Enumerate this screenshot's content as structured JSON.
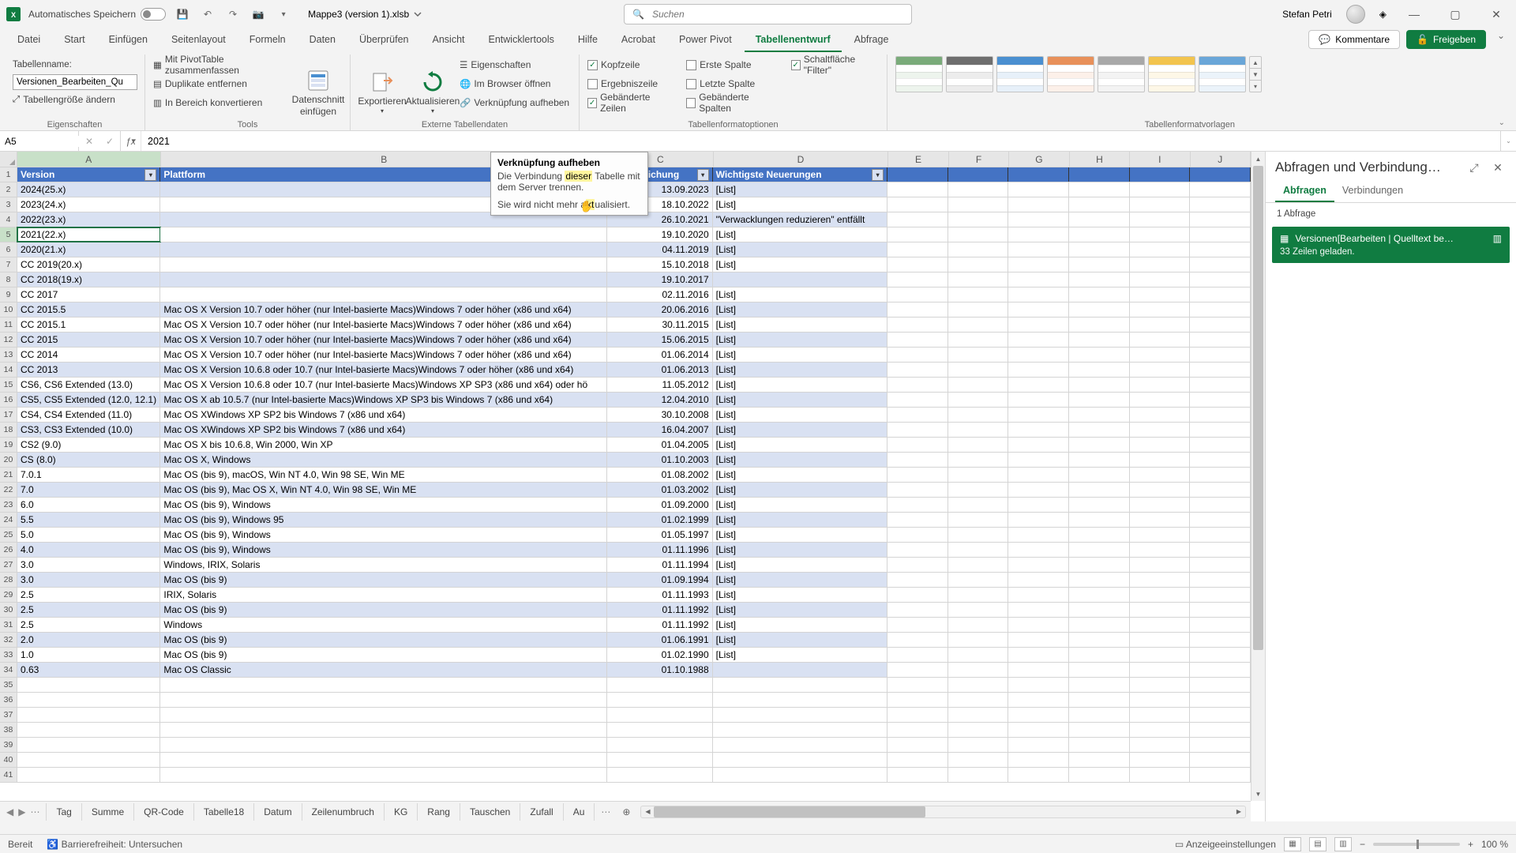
{
  "titlebar": {
    "auto_save_label": "Automatisches Speichern",
    "filename": "Mappe3 (version 1).xlsb",
    "search_placeholder": "Suchen",
    "user_name": "Stefan Petri"
  },
  "ribbon_tabs": [
    "Datei",
    "Start",
    "Einfügen",
    "Seitenlayout",
    "Formeln",
    "Daten",
    "Überprüfen",
    "Ansicht",
    "Entwicklertools",
    "Hilfe",
    "Acrobat",
    "Power Pivot",
    "Tabellenentwurf",
    "Abfrage"
  ],
  "ribbon_tabs_active": 12,
  "ribbon_right": {
    "comments": "Kommentare",
    "share": "Freigeben"
  },
  "groups": {
    "props": {
      "name_label": "Tabellenname:",
      "name_value": "Versionen_Bearbeiten_Qu",
      "resize": "Tabellengröße ändern",
      "group_label": "Eigenschaften"
    },
    "tools": {
      "pivot": "Mit PivotTable zusammenfassen",
      "dupes": "Duplikate entfernen",
      "convert": "In Bereich konvertieren",
      "slicer_top": "Datenschnitt",
      "slicer_bot": "einfügen",
      "group_label": "Tools"
    },
    "external": {
      "export": "Exportieren",
      "refresh": "Aktualisieren",
      "props": "Eigenschaften",
      "browser": "Im Browser öffnen",
      "unlink": "Verknüpfung aufheben",
      "group_label": "Externe Tabellendaten"
    },
    "styleopts": {
      "header_row": "Kopfzeile",
      "total_row": "Ergebniszeile",
      "banded_rows": "Gebänderte Zeilen",
      "first_col": "Erste Spalte",
      "last_col": "Letzte Spalte",
      "banded_cols": "Gebänderte Spalten",
      "filter_btn": "Schaltfläche \"Filter\"",
      "group_label": "Tabellenformatoptionen"
    },
    "styles": {
      "group_label": "Tabellenformatvorlagen"
    }
  },
  "style_colors": [
    "#7aab7a",
    "#6e6e6e",
    "#4a8fd0",
    "#e8905a",
    "#a8a8a8",
    "#f2c44e",
    "#6aa6d8"
  ],
  "namebox": "A5",
  "formula": "2021",
  "col_letters": [
    "A",
    "B",
    "C",
    "D",
    "E",
    "F",
    "G",
    "H",
    "I",
    "J"
  ],
  "table_headers": [
    "Version",
    "Plattform",
    "eröffentlichung",
    "Wichtigste Neuerungen"
  ],
  "rows": [
    {
      "v": "2024(25.x)",
      "p": "",
      "d": "13.09.2023",
      "n": "[List]"
    },
    {
      "v": "2023(24.x)",
      "p": "",
      "d": "18.10.2022",
      "n": "[List]"
    },
    {
      "v": "2022(23.x)",
      "p": "",
      "d": "26.10.2021",
      "n": "\"Verwacklungen reduzieren\" entfällt"
    },
    {
      "v": "2021(22.x)",
      "p": "",
      "d": "19.10.2020",
      "n": "[List]"
    },
    {
      "v": "2020(21.x)",
      "p": "",
      "d": "04.11.2019",
      "n": "[List]"
    },
    {
      "v": "CC 2019(20.x)",
      "p": "",
      "d": "15.10.2018",
      "n": "[List]"
    },
    {
      "v": "CC 2018(19.x)",
      "p": "",
      "d": "19.10.2017",
      "n": ""
    },
    {
      "v": "CC 2017",
      "p": "",
      "d": "02.11.2016",
      "n": "[List]"
    },
    {
      "v": "CC 2015.5",
      "p": "Mac OS X Version 10.7 oder höher (nur Intel-basierte Macs)Windows 7 oder höher (x86 und x64)",
      "d": "20.06.2016",
      "n": "[List]"
    },
    {
      "v": "CC 2015.1",
      "p": "Mac OS X Version 10.7 oder höher (nur Intel-basierte Macs)Windows 7 oder höher (x86 und x64)",
      "d": "30.11.2015",
      "n": "[List]"
    },
    {
      "v": "CC 2015",
      "p": "Mac OS X Version 10.7 oder höher (nur Intel-basierte Macs)Windows 7 oder höher (x86 und x64)",
      "d": "15.06.2015",
      "n": "[List]"
    },
    {
      "v": "CC 2014",
      "p": "Mac OS X Version 10.7 oder höher (nur Intel-basierte Macs)Windows 7 oder höher (x86 und x64)",
      "d": "01.06.2014",
      "n": "[List]"
    },
    {
      "v": "CC 2013",
      "p": "Mac OS X Version 10.6.8 oder 10.7 (nur Intel-basierte Macs)Windows 7 oder höher (x86 und x64)",
      "d": "01.06.2013",
      "n": "[List]"
    },
    {
      "v": "CS6, CS6 Extended (13.0)",
      "p": "Mac OS X Version 10.6.8 oder 10.7 (nur Intel-basierte Macs)Windows XP SP3 (x86 und x64) oder hö",
      "d": "11.05.2012",
      "n": "[List]"
    },
    {
      "v": "CS5, CS5 Extended (12.0, 12.1)",
      "p": "Mac OS X ab 10.5.7 (nur Intel-basierte Macs)Windows XP SP3 bis Windows 7 (x86 und x64)",
      "d": "12.04.2010",
      "n": "[List]"
    },
    {
      "v": "CS4, CS4 Extended (11.0)",
      "p": "Mac OS XWindows XP SP2 bis Windows 7 (x86 und x64)",
      "d": "30.10.2008",
      "n": "[List]"
    },
    {
      "v": "CS3, CS3 Extended (10.0)",
      "p": "Mac OS XWindows XP SP2 bis Windows 7 (x86 und x64)",
      "d": "16.04.2007",
      "n": "[List]"
    },
    {
      "v": "CS2 (9.0)",
      "p": "Mac OS X bis 10.6.8, Win 2000, Win XP",
      "d": "01.04.2005",
      "n": "[List]"
    },
    {
      "v": "CS (8.0)",
      "p": "Mac OS X, Windows",
      "d": "01.10.2003",
      "n": "[List]"
    },
    {
      "v": "7.0.1",
      "p": "Mac OS (bis 9), macOS, Win NT 4.0, Win 98 SE, Win ME",
      "d": "01.08.2002",
      "n": "[List]"
    },
    {
      "v": "7.0",
      "p": "Mac OS (bis 9), Mac OS X, Win NT 4.0, Win 98 SE, Win ME",
      "d": "01.03.2002",
      "n": "[List]"
    },
    {
      "v": "6.0",
      "p": "Mac OS (bis 9), Windows",
      "d": "01.09.2000",
      "n": "[List]"
    },
    {
      "v": "5.5",
      "p": "Mac OS (bis 9), Windows 95",
      "d": "01.02.1999",
      "n": "[List]"
    },
    {
      "v": "5.0",
      "p": "Mac OS (bis 9), Windows",
      "d": "01.05.1997",
      "n": "[List]"
    },
    {
      "v": "4.0",
      "p": "Mac OS (bis 9), Windows",
      "d": "01.11.1996",
      "n": "[List]"
    },
    {
      "v": "3.0",
      "p": "Windows, IRIX, Solaris",
      "d": "01.11.1994",
      "n": "[List]"
    },
    {
      "v": "3.0",
      "p": "Mac OS (bis 9)",
      "d": "01.09.1994",
      "n": "[List]"
    },
    {
      "v": "2.5",
      "p": "IRIX, Solaris",
      "d": "01.11.1993",
      "n": "[List]"
    },
    {
      "v": "2.5",
      "p": "Mac OS (bis 9)",
      "d": "01.11.1992",
      "n": "[List]"
    },
    {
      "v": "2.5",
      "p": "Windows",
      "d": "01.11.1992",
      "n": "[List]"
    },
    {
      "v": "2.0",
      "p": "Mac OS (bis 9)",
      "d": "01.06.1991",
      "n": "[List]"
    },
    {
      "v": "1.0",
      "p": "Mac OS (bis 9)",
      "d": "01.02.1990",
      "n": "[List]"
    },
    {
      "v": "0.63",
      "p": "Mac OS Classic",
      "d": "01.10.1988",
      "n": ""
    }
  ],
  "selected_row_index": 3,
  "tooltip": {
    "title": "Verknüpfung aufheben",
    "body_a": "Die Verbindung ",
    "body_hi1": "dieser",
    "body_b": " Tabelle mit dem Server trennen.",
    "foot_a": "Sie wird nicht mehr a",
    "foot_hi": "kt",
    "foot_b": "ualisiert."
  },
  "tabs": [
    "Tag",
    "Summe",
    "QR-Code",
    "Tabelle18",
    "Datum",
    "Zeilenumbruch",
    "KG",
    "Rang",
    "Tauschen",
    "Zufall",
    "Au"
  ],
  "side": {
    "title": "Abfragen und Verbindung…",
    "tab1": "Abfragen",
    "tab2": "Verbindungen",
    "count": "1 Abfrage",
    "query_name": "Versionen[Bearbeiten | Quelltext be…",
    "query_sub": "33 Zeilen geladen."
  },
  "status": {
    "ready": "Bereit",
    "access": "Barrierefreiheit: Untersuchen",
    "display": "Anzeigeeinstellungen",
    "zoom": "100 %"
  }
}
